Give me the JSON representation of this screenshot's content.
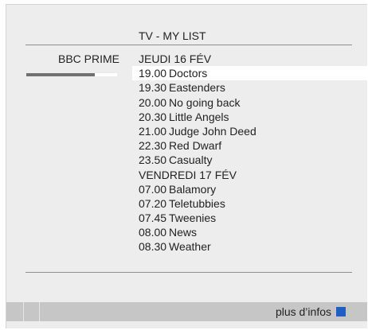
{
  "header": {
    "title": "TV - MY LIST"
  },
  "channel": {
    "name": "BBC PRIME",
    "level": 0.75
  },
  "list": {
    "items": [
      {
        "type": "date",
        "text": "JEUDI 16 FÉV"
      },
      {
        "type": "program",
        "time": "19.00",
        "title": "Doctors",
        "selected": true
      },
      {
        "type": "program",
        "time": "19.30",
        "title": "Eastenders"
      },
      {
        "type": "program",
        "time": "20.00",
        "title": "No going back"
      },
      {
        "type": "program",
        "time": "20.30",
        "title": "Little Angels"
      },
      {
        "type": "program",
        "time": "21.00",
        "title": "Judge John Deed"
      },
      {
        "type": "program",
        "time": "22.30",
        "title": "Red Dwarf"
      },
      {
        "type": "program",
        "time": "23.50",
        "title": "Casualty"
      },
      {
        "type": "date",
        "text": "VENDREDI 17 FÉV"
      },
      {
        "type": "program",
        "time": "07.00",
        "title": "Balamory"
      },
      {
        "type": "program",
        "time": "07.20",
        "title": "Teletubbies"
      },
      {
        "type": "program",
        "time": "07.45",
        "title": "Tweenies"
      },
      {
        "type": "program",
        "time": "08.00",
        "title": "News"
      },
      {
        "type": "program",
        "time": "08.30",
        "title": "Weather"
      }
    ]
  },
  "footer": {
    "more_info_label": "plus d’infos",
    "more_info_key_color": "#1f5fc4",
    "key_icon": "blue-square-icon"
  }
}
